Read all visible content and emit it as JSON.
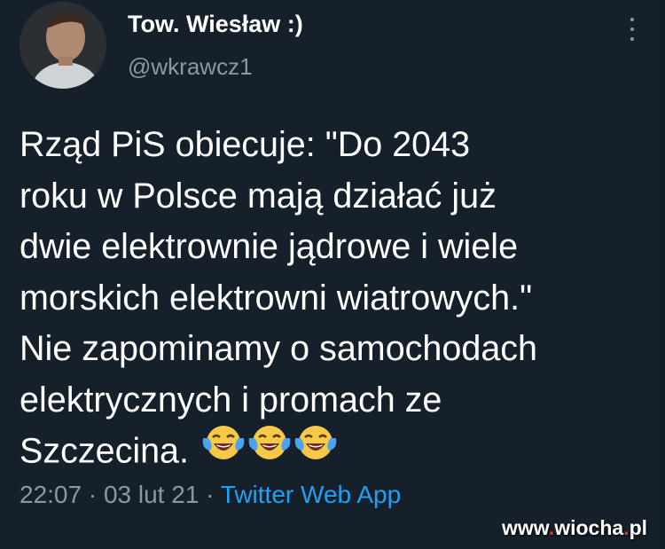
{
  "user": {
    "display_name": "Tow. Wiesław :)",
    "handle": "@wkrawcz1",
    "avatar_icon": "avatar-photo"
  },
  "tweet": {
    "lines": [
      "Rząd PiS obiecuje: \"Do 2043",
      "roku w Polsce mają działać już",
      "dwie elektrownie jądrowe i wiele",
      "morskich elektrowni wiatrowych.\"",
      "Nie zapominamy o samochodach",
      "elektrycznych i promach ze",
      "Szczecina."
    ],
    "emoji": [
      "face-with-tears-of-joy-icon",
      "face-with-tears-of-joy-icon",
      "face-with-tears-of-joy-icon"
    ]
  },
  "meta": {
    "time": "22:07",
    "separator": "·",
    "date": "03 lut 21",
    "source": "Twitter Web App"
  },
  "watermark": {
    "prefix": "www",
    "dot1": ".",
    "name": "wiocha",
    "dot2": ".",
    "tld": "pl"
  },
  "colors": {
    "background": "#15202b",
    "text": "#ffffff",
    "secondary": "#8899a6",
    "link": "#1da1f2",
    "watermark_dot": "#e8312f"
  },
  "icons": {
    "more": "more-vertical-icon"
  }
}
